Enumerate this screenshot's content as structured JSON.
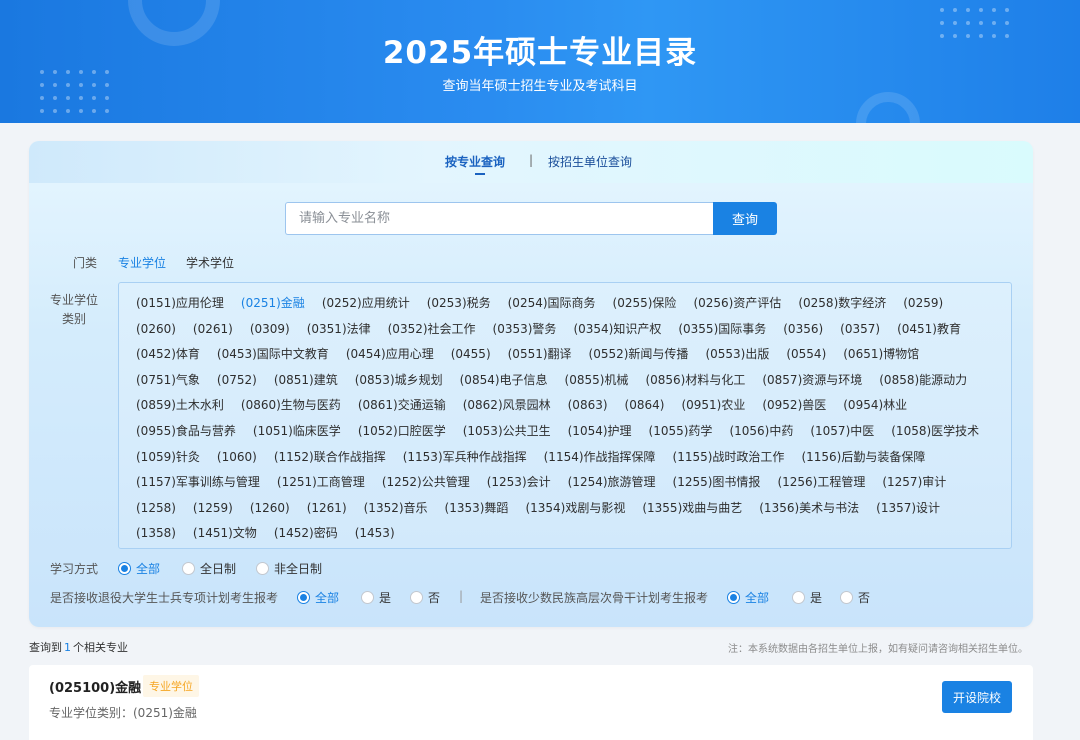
{
  "banner": {
    "title": "2025年硕士专业目录",
    "subtitle": "查询当年硕士招生专业及考试科目"
  },
  "tabs": {
    "by_major": "按专业查询",
    "separator": "|",
    "by_unit": "按招生单位查询",
    "active": "by_major"
  },
  "search": {
    "placeholder": "请输入专业名称",
    "value": "",
    "button": "查询"
  },
  "category": {
    "label": "门类",
    "options": [
      "专业学位",
      "学术学位"
    ],
    "selected": "专业学位"
  },
  "degree_types": {
    "label": "专业学位类别",
    "selected": "(0251)金融",
    "items": [
      "(0151)应用伦理",
      "(0251)金融",
      "(0252)应用统计",
      "(0253)税务",
      "(0254)国际商务",
      "(0255)保险",
      "(0256)资产评估",
      "(0258)数字经济",
      "(0259)",
      "(0260)",
      "(0261)",
      "(0309)",
      "(0351)法律",
      "(0352)社会工作",
      "(0353)警务",
      "(0354)知识产权",
      "(0355)国际事务",
      "(0356)",
      "(0357)",
      "(0451)教育",
      "(0452)体育",
      "(0453)国际中文教育",
      "(0454)应用心理",
      "(0455)",
      "(0551)翻译",
      "(0552)新闻与传播",
      "(0553)出版",
      "(0554)",
      "(0651)博物馆",
      "(0751)气象",
      "(0752)",
      "(0851)建筑",
      "(0853)城乡规划",
      "(0854)电子信息",
      "(0855)机械",
      "(0856)材料与化工",
      "(0857)资源与环境",
      "(0858)能源动力",
      "(0859)土木水利",
      "(0860)生物与医药",
      "(0861)交通运输",
      "(0862)风景园林",
      "(0863)",
      "(0864)",
      "(0951)农业",
      "(0952)兽医",
      "(0954)林业",
      "(0955)食品与营养",
      "(1051)临床医学",
      "(1052)口腔医学",
      "(1053)公共卫生",
      "(1054)护理",
      "(1055)药学",
      "(1056)中药",
      "(1057)中医",
      "(1058)医学技术",
      "(1059)针灸",
      "(1060)",
      "(1152)联合作战指挥",
      "(1153)军兵种作战指挥",
      "(1154)作战指挥保障",
      "(1155)战时政治工作",
      "(1156)后勤与装备保障",
      "(1157)军事训练与管理",
      "(1251)工商管理",
      "(1252)公共管理",
      "(1253)会计",
      "(1254)旅游管理",
      "(1255)图书情报",
      "(1256)工程管理",
      "(1257)审计",
      "(1258)",
      "(1259)",
      "(1260)",
      "(1261)",
      "(1352)音乐",
      "(1353)舞蹈",
      "(1354)戏剧与影视",
      "(1355)戏曲与曲艺",
      "(1356)美术与书法",
      "(1357)设计",
      "(1358)",
      "(1451)文物",
      "(1452)密码",
      "(1453)"
    ]
  },
  "study_mode": {
    "label": "学习方式",
    "options": [
      "全部",
      "全日制",
      "非全日制"
    ],
    "selected": "全部"
  },
  "veteran_plan": {
    "label": "是否接收退役大学生士兵专项计划考生报考",
    "options": [
      "全部",
      "是",
      "否"
    ],
    "selected": "全部"
  },
  "minority_plan": {
    "label": "是否接收少数民族高层次骨干计划考生报考",
    "options": [
      "全部",
      "是",
      "否"
    ],
    "selected": "全部"
  },
  "results": {
    "prefix": "查询到",
    "count": "1",
    "suffix": "个相关专业",
    "note": "注：本系统数据由各招生单位上报，如有疑问请咨询相关招生单位。",
    "items": [
      {
        "title": "(025100)金融",
        "badge": "专业学位",
        "subtitle": "专业学位类别：(0251)金融",
        "button": "开设院校"
      }
    ]
  },
  "colors": {
    "accent": "#1a82e3",
    "banner_start": "#1a78e0",
    "badge_text": "#f5a623",
    "badge_bg": "#fef6e6"
  }
}
